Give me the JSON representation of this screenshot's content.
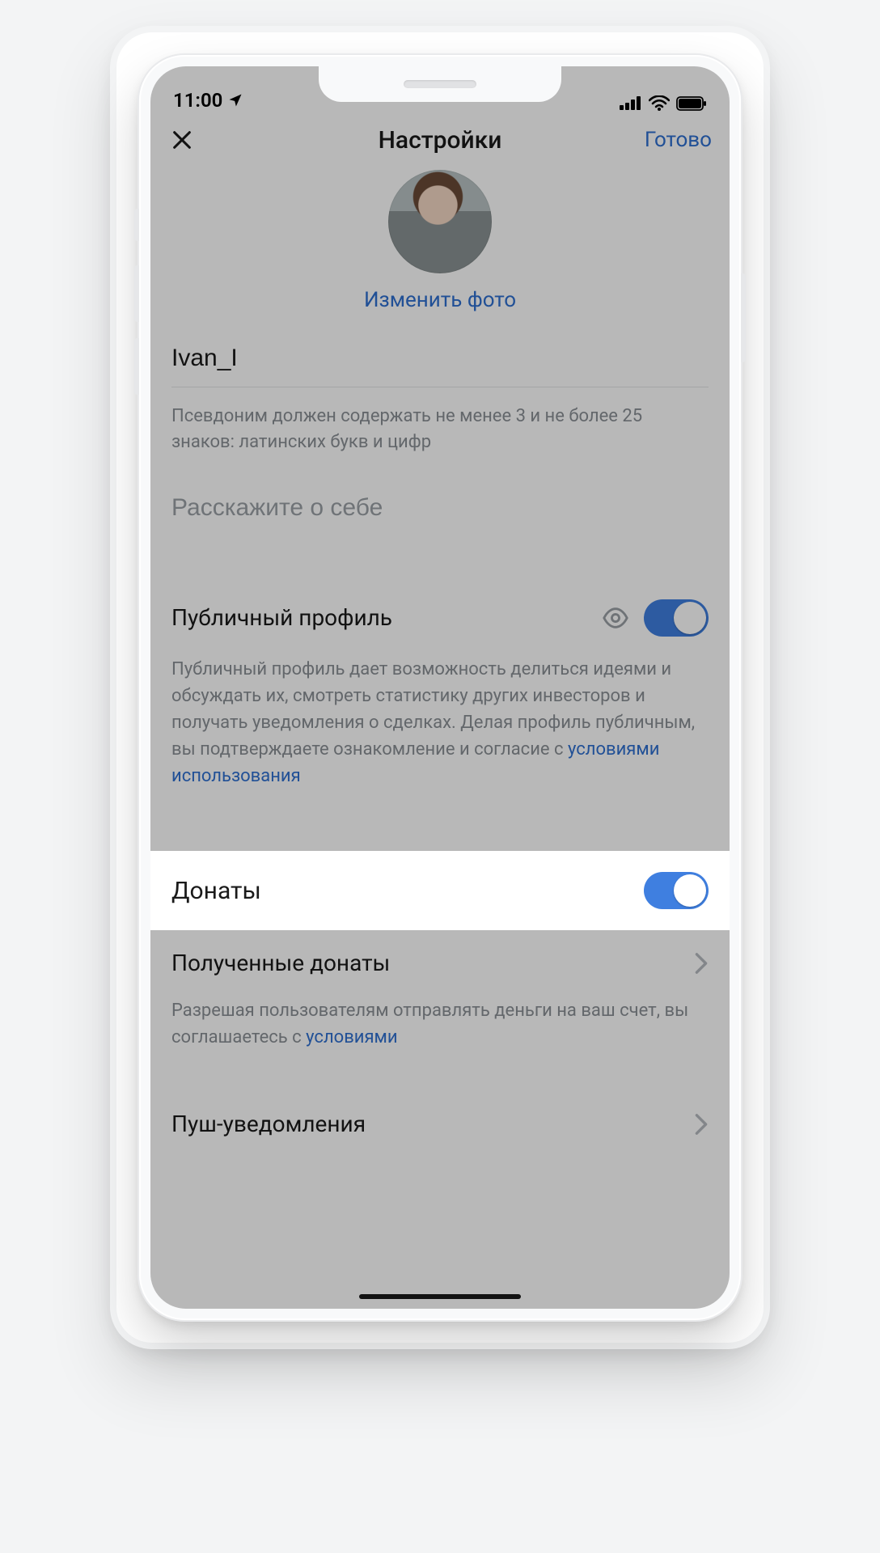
{
  "status": {
    "time": "11:00"
  },
  "nav": {
    "title": "Настройки",
    "done": "Готово"
  },
  "profile": {
    "change_photo": "Изменить фото",
    "username": "Ivan_I",
    "username_help": "Псевдоним должен содержать не менее 3 и не более 25 знаков: латинских букв и цифр",
    "about_placeholder": "Расскажите о себе"
  },
  "public": {
    "label": "Публичный профиль",
    "desc": "Публичный профиль дает возможность делиться идеями и обсуждать их, смотреть статистику других инвесторов и получать уведомления о сделках. Делая профиль публичным, вы подтверждаете ознакомление и согласие с ",
    "terms": "условиями использования"
  },
  "donations": {
    "label": "Донаты",
    "received_label": "Полученные донаты",
    "consent_prefix": "Разрешая пользователям отправлять деньги на ваш счет, вы соглашаетесь с ",
    "consent_link": "условиями"
  },
  "push": {
    "label": "Пуш-уведомления"
  }
}
